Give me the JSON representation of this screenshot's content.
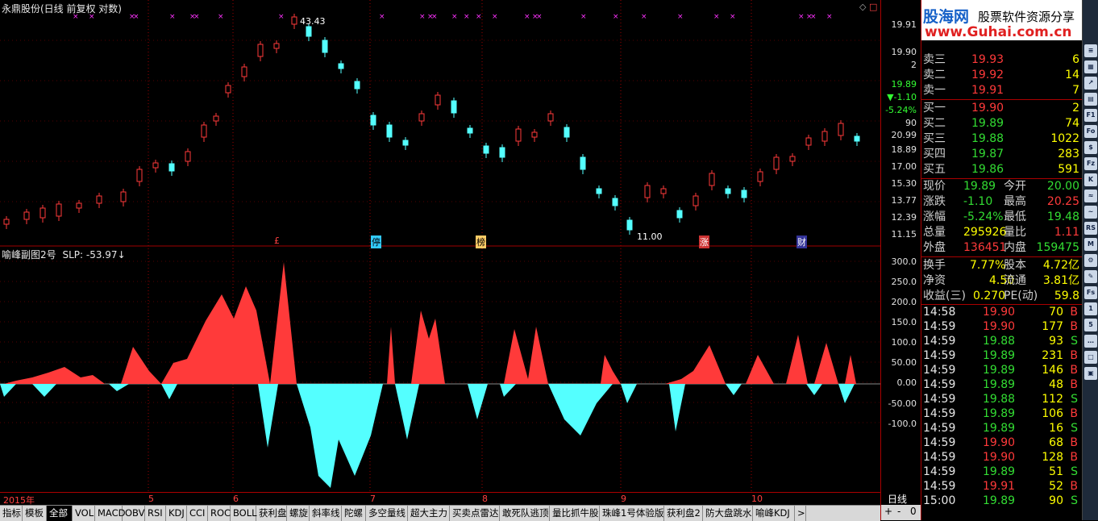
{
  "window_title": "永鼎股份(日线 前复权 对数)",
  "main_pane": {
    "high_label": "43.43",
    "low_label": "11.00",
    "event_markers": [
      "£",
      "停",
      "榜",
      "涨",
      "财"
    ],
    "price_axis": [
      "19.91",
      "19.90",
      "2",
      "19.89",
      "▼-1.10",
      "-5.24%",
      "90",
      "20.99",
      "18.89",
      "17.00",
      "15.30",
      "13.77",
      "12.39",
      "11.15"
    ]
  },
  "sub_pane": {
    "title": "喻峰副图2号",
    "slp_label": "SLP: -53.97",
    "axis": [
      "300.0",
      "250.0",
      "200.0",
      "150.0",
      "100.0",
      "50.00",
      "0.00",
      "-50.00",
      "-100.0"
    ]
  },
  "date_axis": [
    "2015年",
    "5",
    "6",
    "7",
    "8",
    "9",
    "10"
  ],
  "period_label": "日线",
  "zoom_controls": [
    "+",
    "-",
    "0"
  ],
  "tabs": [
    "指标",
    "模板",
    "全部",
    "VOL",
    "MACD",
    "OBV",
    "RSI",
    "KDJ",
    "CCI",
    "ROC",
    "BOLL",
    "获利盘",
    "螺旋",
    "斜率线",
    "陀螺",
    "多空量线",
    "超大主力",
    "买卖点雷达",
    "敢死队逃顶",
    "量比抓牛股",
    "珠峰1号体验版",
    "获利盘2",
    "防大盘跳水",
    "喻峰KDJ",
    ">"
  ],
  "logo": {
    "brand": "股海网",
    "slogan": "股票软件资源分享",
    "url": "www.Guhai.com.cn"
  },
  "order_book": {
    "sell": [
      {
        "label": "卖三",
        "price": "19.93",
        "vol": "6"
      },
      {
        "label": "卖二",
        "price": "19.92",
        "vol": "14"
      },
      {
        "label": "卖一",
        "price": "19.91",
        "vol": "7"
      }
    ],
    "buy": [
      {
        "label": "买一",
        "price": "19.90",
        "vol": "2"
      },
      {
        "label": "买二",
        "price": "19.89",
        "vol": "74"
      },
      {
        "label": "买三",
        "price": "19.88",
        "vol": "1022"
      },
      {
        "label": "买四",
        "price": "19.87",
        "vol": "283"
      },
      {
        "label": "买五",
        "price": "19.86",
        "vol": "591"
      }
    ]
  },
  "stats": {
    "xj_l": "现价",
    "xj": "19.89",
    "jk_l": "今开",
    "jk": "20.00",
    "zd_l": "涨跌",
    "zd": "-1.10",
    "zg_l": "最高",
    "zg": "20.25",
    "zf_l": "涨幅",
    "zf": "-5.24%",
    "zdi_l": "最低",
    "zdi": "19.48",
    "zl_l": "总量",
    "zl": "295926",
    "lb_l": "量比",
    "lb": "1.11",
    "wp_l": "外盘",
    "wp": "136451",
    "np_l": "内盘",
    "np": "159475",
    "hs_l": "换手",
    "hs": "7.77%",
    "gb_l": "股本",
    "gb": "4.72亿",
    "jz_l": "净资",
    "jz": "4.50",
    "lt_l": "流通",
    "lt": "3.81亿",
    "sy_l": "收益(三)",
    "sy": "0.270",
    "pe_l": "PE(动)",
    "pe": "59.8"
  },
  "ticks": [
    {
      "t": "14:58",
      "p": "19.90",
      "v": "70",
      "s": "B"
    },
    {
      "t": "14:59",
      "p": "19.90",
      "v": "177",
      "s": "B"
    },
    {
      "t": "14:59",
      "p": "19.88",
      "v": "93",
      "s": "S"
    },
    {
      "t": "14:59",
      "p": "19.89",
      "v": "231",
      "s": "B"
    },
    {
      "t": "14:59",
      "p": "19.89",
      "v": "146",
      "s": "B"
    },
    {
      "t": "14:59",
      "p": "19.89",
      "v": "48",
      "s": "B"
    },
    {
      "t": "14:59",
      "p": "19.88",
      "v": "112",
      "s": "S"
    },
    {
      "t": "14:59",
      "p": "19.89",
      "v": "106",
      "s": "B"
    },
    {
      "t": "14:59",
      "p": "19.89",
      "v": "16",
      "s": "S"
    },
    {
      "t": "14:59",
      "p": "19.90",
      "v": "68",
      "s": "B"
    },
    {
      "t": "14:59",
      "p": "19.90",
      "v": "128",
      "s": "B"
    },
    {
      "t": "14:59",
      "p": "19.89",
      "v": "51",
      "s": "S"
    },
    {
      "t": "14:59",
      "p": "19.91",
      "v": "52",
      "s": "B"
    },
    {
      "t": "15:00",
      "p": "19.89",
      "v": "90",
      "s": "S"
    }
  ],
  "colors": {
    "up": "#ff3a3a",
    "down": "#54ffff",
    "grid": "#a00000",
    "accent": "#ffff00"
  }
}
